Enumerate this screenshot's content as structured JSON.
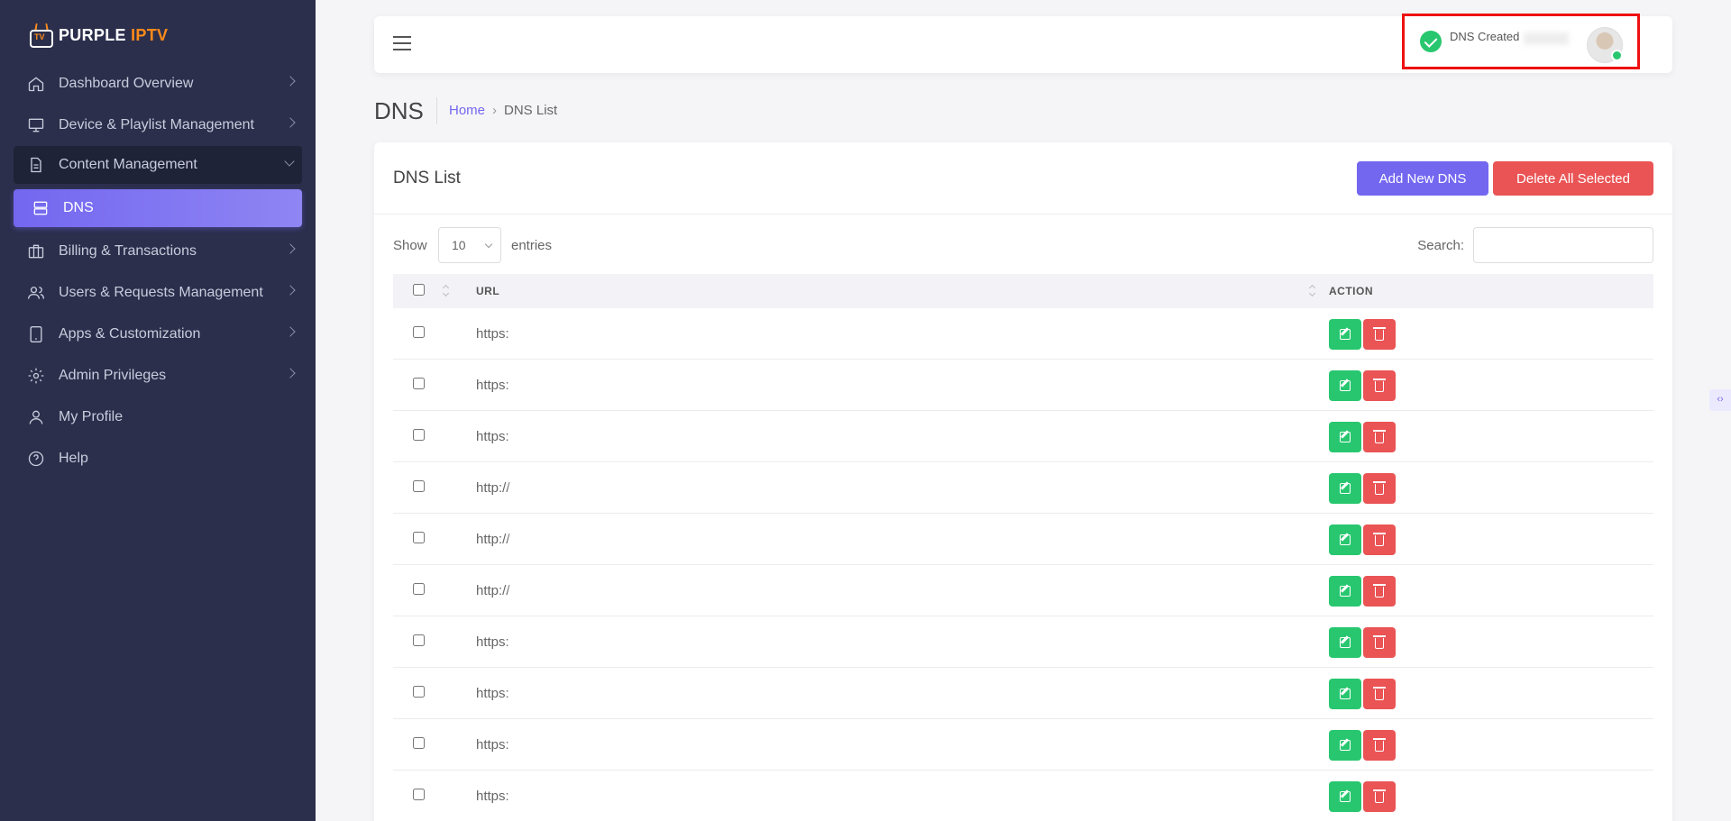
{
  "brand": {
    "name_main": "PURPLE",
    "name_accent": "IPTV",
    "badge": "TV"
  },
  "sidebar": {
    "items": [
      {
        "label": "Dashboard Overview",
        "icon": "home-icon"
      },
      {
        "label": "Device & Playlist Management",
        "icon": "monitor-icon"
      },
      {
        "label": "Content Management",
        "icon": "document-icon"
      },
      {
        "label": "DNS",
        "icon": "server-icon"
      },
      {
        "label": "Billing & Transactions",
        "icon": "briefcase-icon"
      },
      {
        "label": "Users & Requests Management",
        "icon": "users-icon"
      },
      {
        "label": "Apps & Customization",
        "icon": "tablet-icon"
      },
      {
        "label": "Admin Privileges",
        "icon": "gear-icon"
      },
      {
        "label": "My Profile",
        "icon": "user-icon"
      },
      {
        "label": "Help",
        "icon": "help-icon"
      }
    ]
  },
  "toast": {
    "message": "DNS Created"
  },
  "header": {
    "title": "DNS",
    "breadcrumb_home": "Home",
    "breadcrumb_current": "DNS List"
  },
  "card": {
    "title": "DNS List",
    "add_button": "Add New DNS",
    "delete_button": "Delete All Selected",
    "show_label": "Show",
    "entries_value": "10",
    "entries_label": "entries",
    "search_label": "Search:"
  },
  "table": {
    "columns": [
      "URL",
      "ACTION"
    ],
    "rows": [
      {
        "url": "https:"
      },
      {
        "url": "https:"
      },
      {
        "url": "https:"
      },
      {
        "url": "http://"
      },
      {
        "url": "http://"
      },
      {
        "url": "http://"
      },
      {
        "url": "https:"
      },
      {
        "url": "https:"
      },
      {
        "url": "https:"
      },
      {
        "url": "https:"
      }
    ]
  },
  "colors": {
    "sidebar": "#2b2f4c",
    "primary": "#7367f0",
    "success": "#28c76f",
    "danger": "#ea5455",
    "brand_accent": "#ff8a1a"
  }
}
